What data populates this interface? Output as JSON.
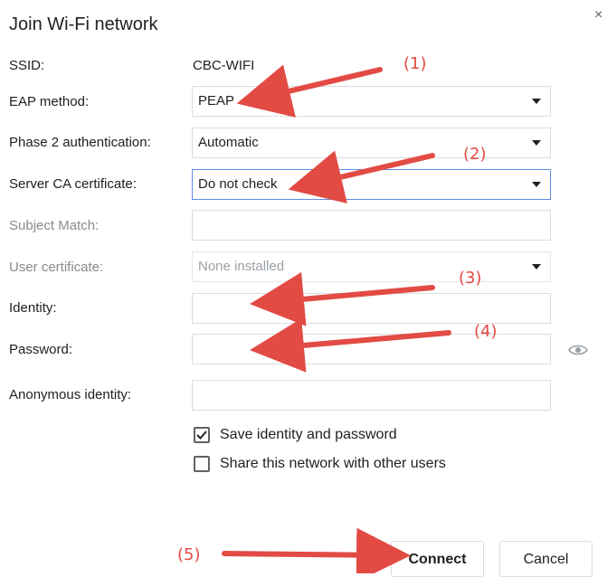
{
  "dialog": {
    "title": "Join Wi-Fi network",
    "close_glyph": "×"
  },
  "form": {
    "ssid": {
      "label": "SSID:",
      "value": "CBC-WIFI"
    },
    "eap_method": {
      "label": "EAP method:",
      "value": "PEAP"
    },
    "phase2": {
      "label": "Phase 2 authentication:",
      "value": "Automatic"
    },
    "server_ca": {
      "label": "Server CA certificate:",
      "value": "Do not check"
    },
    "subject_match": {
      "label": "Subject Match:",
      "value": ""
    },
    "user_cert": {
      "label": "User certificate:",
      "value": "None installed"
    },
    "identity": {
      "label": "Identity:",
      "value": ""
    },
    "password": {
      "label": "Password:",
      "value": ""
    },
    "anon_identity": {
      "label": "Anonymous identity:",
      "value": ""
    }
  },
  "options": {
    "save_identity": {
      "label": "Save identity and password",
      "checked": true
    },
    "share_network": {
      "label": "Share this network with other users",
      "checked": false
    }
  },
  "buttons": {
    "connect": "Connect",
    "cancel": "Cancel"
  },
  "annotations": {
    "n1": "(1)",
    "n2": "(2)",
    "n3": "(3)",
    "n4": "(4)",
    "n5": "(5)",
    "color": "#e24b44"
  },
  "icons": {
    "close": "close-icon",
    "dropdown": "chevron-down-icon",
    "show_password": "eye-icon",
    "check": "checkmark-icon"
  }
}
